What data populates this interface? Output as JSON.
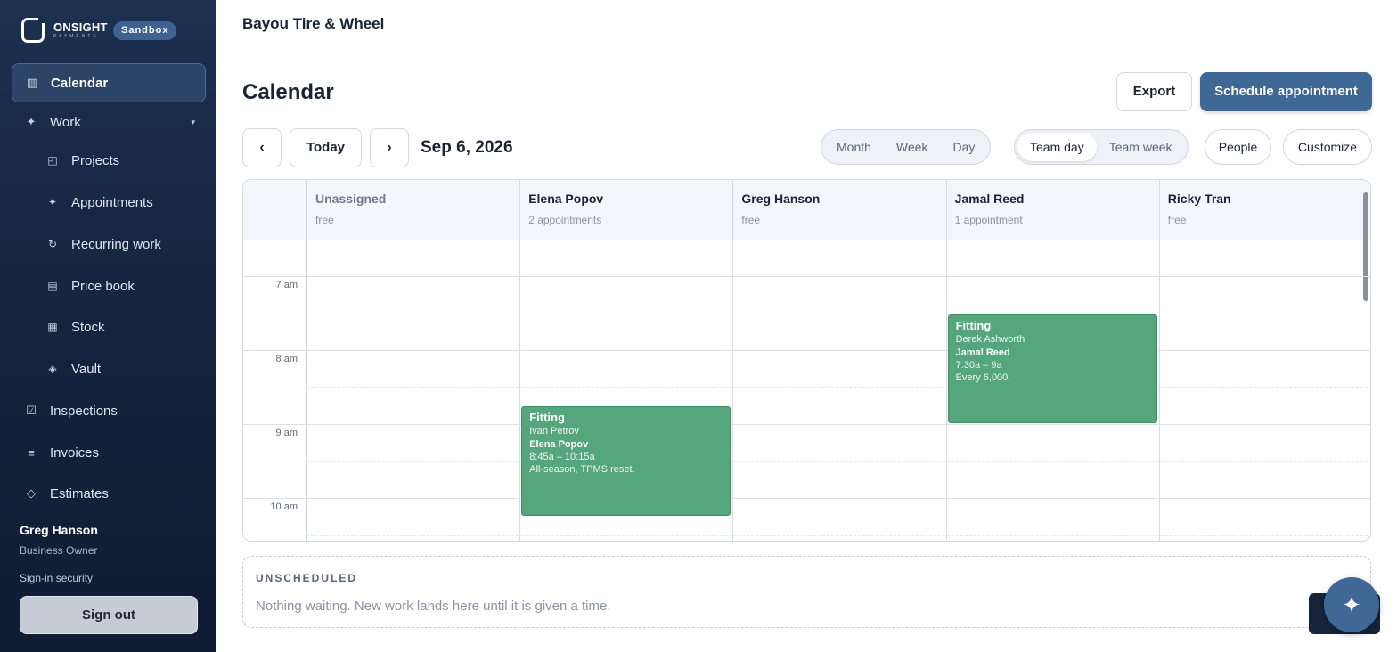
{
  "brand": {
    "name": "ONSIGHT",
    "sub": "PAYMENTS",
    "env_badge": "Sandbox"
  },
  "sidebar": {
    "items": [
      {
        "label": "Calendar",
        "icon": "calendar-icon",
        "glyph": "▥",
        "active": true,
        "sub": false
      },
      {
        "label": "Work",
        "icon": "sparkle-icon",
        "glyph": "✦",
        "active": false,
        "sub": false,
        "expandable": true
      },
      {
        "label": "Projects",
        "icon": "projects-icon",
        "glyph": "◰",
        "active": false,
        "sub": true
      },
      {
        "label": "Appointments",
        "icon": "sparkle-icon",
        "glyph": "✦",
        "active": false,
        "sub": true
      },
      {
        "label": "Recurring work",
        "icon": "refresh-icon",
        "glyph": "↻",
        "active": false,
        "sub": true
      },
      {
        "label": "Price book",
        "icon": "book-icon",
        "glyph": "▤",
        "active": false,
        "sub": true
      },
      {
        "label": "Stock",
        "icon": "grid-icon",
        "glyph": "▦",
        "active": false,
        "sub": true
      },
      {
        "label": "Vault",
        "icon": "vault-icon",
        "glyph": "◈",
        "active": false,
        "sub": true
      },
      {
        "label": "Inspections",
        "icon": "checkbox-icon",
        "glyph": "☑",
        "active": false,
        "sub": false
      },
      {
        "label": "Invoices",
        "icon": "list-icon",
        "glyph": "≡",
        "active": false,
        "sub": false
      },
      {
        "label": "Estimates",
        "icon": "diamond-icon",
        "glyph": "◇",
        "active": false,
        "sub": false
      }
    ],
    "user": {
      "name": "Greg Hanson",
      "role": "Business Owner"
    },
    "signin_security": "Sign-in security",
    "sign_out": "Sign out"
  },
  "header": {
    "business": "Bayou Tire & Wheel"
  },
  "page": {
    "title": "Calendar",
    "export_label": "Export",
    "schedule_label": "Schedule appointment",
    "prev_label": "‹",
    "today_label": "Today",
    "next_label": "›",
    "date": "Sep 6, 2026",
    "views": [
      "Month",
      "Week",
      "Day"
    ],
    "team_views": [
      "Team day",
      "Team week"
    ],
    "team_active": "Team day",
    "people_label": "People",
    "customize_label": "Customize"
  },
  "calendar": {
    "columns": [
      {
        "name": "Unassigned",
        "count": "free",
        "muted": true
      },
      {
        "name": "Elena Popov",
        "count": "2 appointments",
        "muted": false
      },
      {
        "name": "Greg Hanson",
        "count": "free",
        "muted": false
      },
      {
        "name": "Jamal Reed",
        "count": "1 appointment",
        "muted": false
      },
      {
        "name": "Ricky Tran",
        "count": "free",
        "muted": false
      }
    ],
    "time_labels": [
      "7 am",
      "8 am",
      "9 am",
      "10 am"
    ],
    "appointments": [
      {
        "column": 3,
        "title": "Fitting",
        "customer": "Derek Ashworth",
        "tech": "Jamal Reed",
        "time": "7:30a – 9a",
        "note": "Every 6,000.",
        "start_hour": 7.5,
        "end_hour": 9.0
      },
      {
        "column": 1,
        "title": "Fitting",
        "customer": "Ivan Petrov",
        "tech": "Elena Popov",
        "time": "8:45a – 10:15a",
        "note": "All-season, TPMS reset.",
        "start_hour": 8.75,
        "end_hour": 10.25
      }
    ],
    "accent_color": "#55a67c"
  },
  "unscheduled": {
    "title": "UNSCHEDULED",
    "message": "Nothing waiting. New work lands here until it is given a time."
  },
  "fab": {
    "icon": "sparkle-icon",
    "glyph": "✦"
  },
  "colors": {
    "sidebar": "#13223b",
    "primary": "#3f6896",
    "appointment": "#55a67c"
  }
}
